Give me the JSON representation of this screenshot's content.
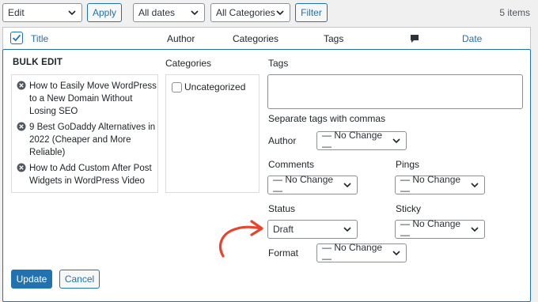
{
  "toolbar": {
    "bulk_action_value": "Edit",
    "apply_label": "Apply",
    "dates_value": "All dates",
    "categories_value": "All Categories",
    "filter_label": "Filter",
    "items_count": "5 items"
  },
  "table_header": {
    "title": "Title",
    "author": "Author",
    "categories": "Categories",
    "tags": "Tags",
    "date": "Date"
  },
  "bulk_edit": {
    "heading": "BULK EDIT",
    "posts": [
      "How to Easily Move WordPress to a New Domain Without Losing SEO",
      "9 Best GoDaddy Alternatives in 2022 (Cheaper and More Reliable)",
      "How to Add Custom After Post Widgets in WordPress Video"
    ],
    "categories_label": "Categories",
    "category_option": "Uncategorized",
    "tags_label": "Tags",
    "tags_help": "Separate tags with commas",
    "author_label": "Author",
    "author_value": "— No Change —",
    "comments_label": "Comments",
    "comments_value": "— No Change —",
    "pings_label": "Pings",
    "pings_value": "— No Change —",
    "status_label": "Status",
    "status_value": "Draft",
    "sticky_label": "Sticky",
    "sticky_value": "— No Change —",
    "format_label": "Format",
    "format_value": "— No Change —",
    "update_label": "Update",
    "cancel_label": "Cancel"
  },
  "colors": {
    "accent": "#2271b1",
    "arrow": "#e8432e"
  }
}
